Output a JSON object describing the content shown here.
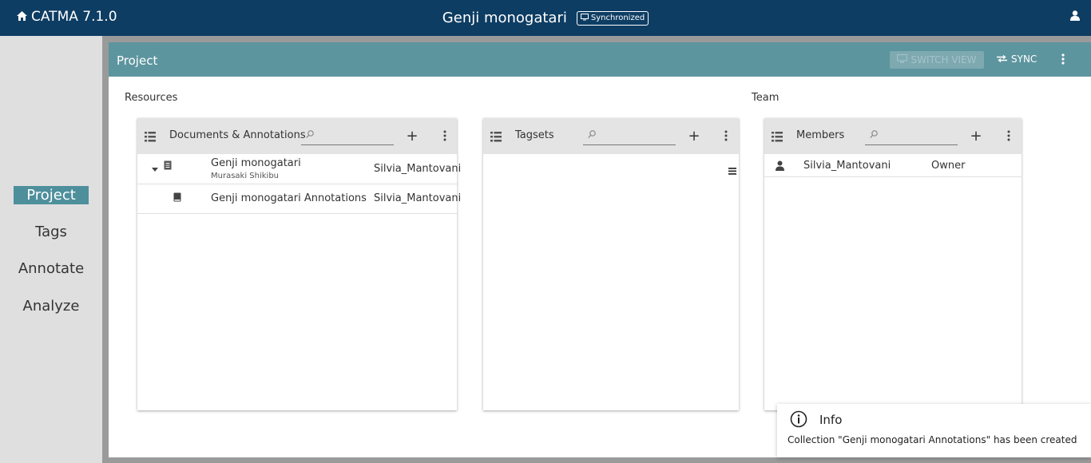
{
  "app": {
    "name": "CATMA 7.1.0",
    "document_title": "Genji monogatari",
    "sync_status": "Synchronized"
  },
  "nav": {
    "items": [
      "Project",
      "Tags",
      "Annotate",
      "Analyze"
    ],
    "active": "Project"
  },
  "project": {
    "title": "Project",
    "switch_view_label": "SWITCH VIEW",
    "sync_label": "SYNC",
    "resources_label": "Resources",
    "team_label": "Team"
  },
  "documents_panel": {
    "title": "Documents & Annotations",
    "search_placeholder": "",
    "rows": [
      {
        "name": "Genji monogatari",
        "author": "Murasaki Shikibu",
        "owner": "Silvia_Mantovani"
      },
      {
        "name": "Genji monogatari Annotations",
        "owner": "Silvia_Mantovani"
      }
    ]
  },
  "tagsets_panel": {
    "title": "Tagsets",
    "search_placeholder": ""
  },
  "members_panel": {
    "title": "Members",
    "search_placeholder": "",
    "rows": [
      {
        "name": "Silvia_Mantovani",
        "role": "Owner"
      }
    ]
  },
  "notification": {
    "title": "Info",
    "message": "Collection \"Genji monogatari Annotations\" has been created"
  },
  "colors": {
    "topbar": "#0e3d63",
    "project_header": "#5d959f",
    "active_nav": "#4e8f9c"
  }
}
